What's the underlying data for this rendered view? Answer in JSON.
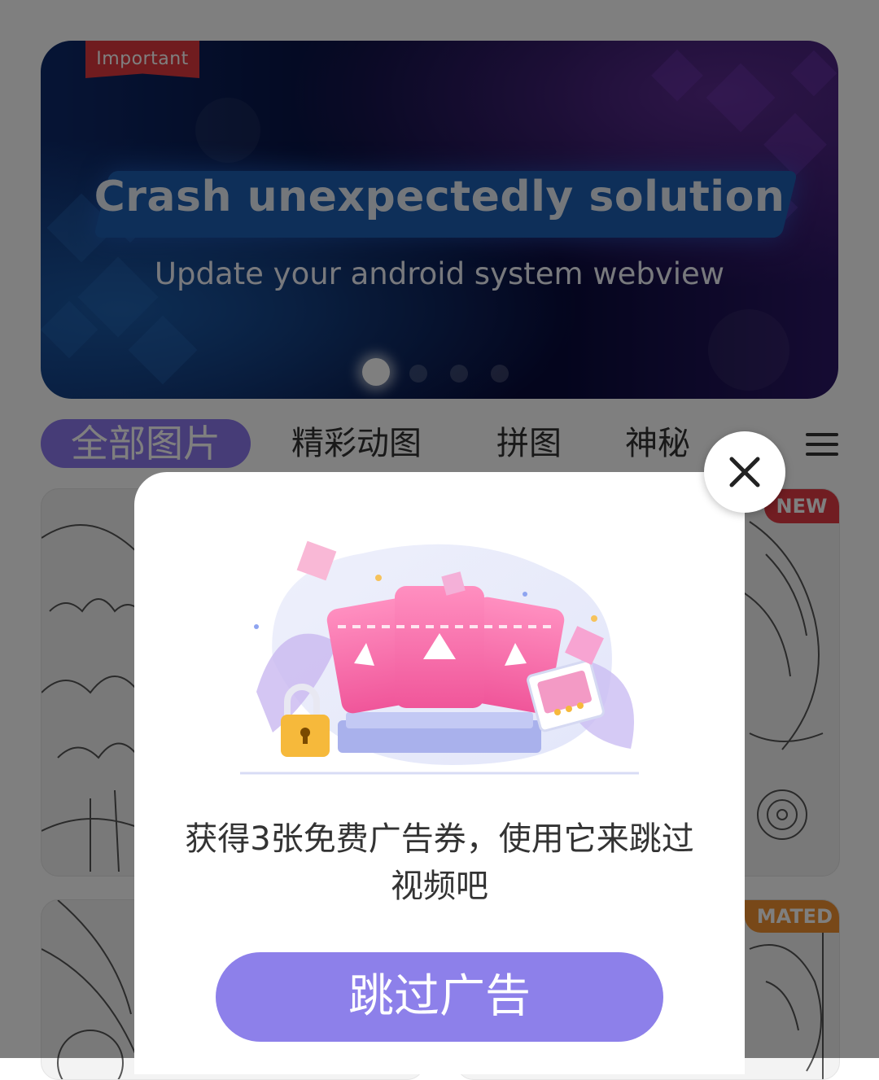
{
  "banner": {
    "ribbon": "Important",
    "headline": "Crash unexpectedly solution",
    "subline": "Update your android system webview",
    "page_indicator": {
      "total": 4,
      "active": 1
    }
  },
  "tabs": {
    "items": [
      "全部图片",
      "精彩动图",
      "拼图",
      "神秘"
    ],
    "active_index": 0,
    "menu_icon": "menu-icon"
  },
  "cards": {
    "badge_new": "NEW",
    "badge_animated": "MATED"
  },
  "dialog": {
    "message_line1": "获得3张免费广告券，使用它来跳过",
    "message_line2": "视频吧",
    "skip_button": "跳过广告",
    "close_icon": "close-icon",
    "illustration_icons": [
      "ticket-icon",
      "lock-icon",
      "photo-icon"
    ]
  },
  "colors": {
    "accent": "#8d80ea",
    "tab_active": "#8d78ee",
    "badge_new": "#e23a44",
    "badge_animated": "#f09030",
    "ribbon": "#e0393e",
    "scrim": "rgba(0,0,0,0.5)"
  }
}
